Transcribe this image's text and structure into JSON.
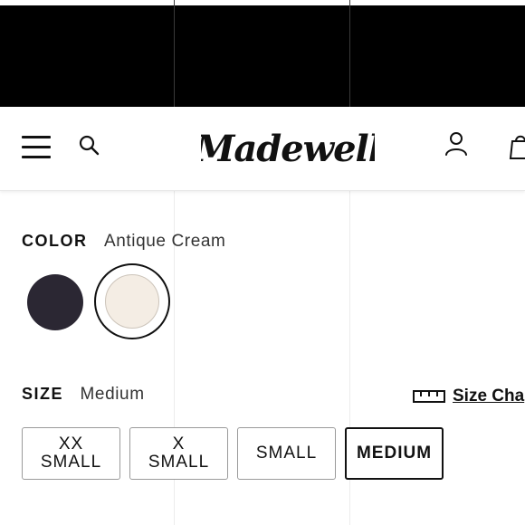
{
  "header": {
    "logo_text": "Madewell",
    "icons": [
      "menu-icon",
      "search-icon",
      "account-icon",
      "bag-icon"
    ]
  },
  "color": {
    "label": "COLOR",
    "selected_value": "Antique Cream",
    "swatches": [
      {
        "name": "dark",
        "hex": "#2b2733",
        "selected": false
      },
      {
        "name": "Antique Cream",
        "hex": "#f4ede4",
        "selected": true
      }
    ]
  },
  "size": {
    "label": "SIZE",
    "selected_value": "Medium",
    "size_chart_label": "Size Cha",
    "options": [
      {
        "line1": "XX",
        "line2": "SMALL",
        "selected": false
      },
      {
        "line1": "X",
        "line2": "SMALL",
        "selected": false
      },
      {
        "line1": "SMALL",
        "line2": "",
        "selected": false
      },
      {
        "line1": "MEDIUM",
        "line2": "",
        "selected": true
      }
    ]
  }
}
